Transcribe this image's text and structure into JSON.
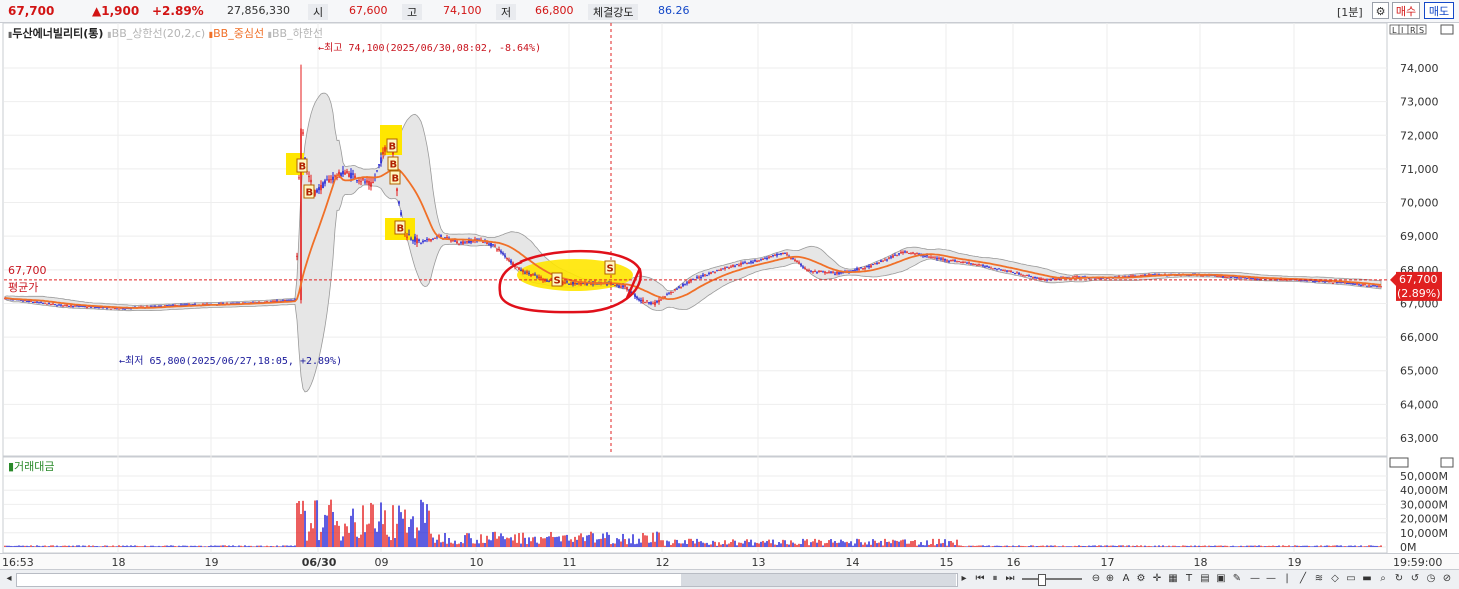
{
  "header": {
    "price": "67,700",
    "change": "▲1,900",
    "change_pct": "+2.89%",
    "volume": "27,856,330",
    "open_label": "시",
    "open_value": "67,600",
    "high_label": "고",
    "high_value": "74,100",
    "low_label": "저",
    "low_value": "66,800",
    "strength_label": "체결강도",
    "strength_value": "86.26",
    "interval": "[1분]",
    "buy_label": "매수",
    "sell_label": "매도"
  },
  "main_legend": {
    "name": "두산에너빌리티(통)",
    "bb_upper": "BB_상한선(20,2,c)",
    "bb_mid": "BB_중심선",
    "bb_lower": "BB_하한선"
  },
  "annotations": {
    "high": "←최고 74,100(2025/06/30,08:02, -8.64%)",
    "low": "←최저 65,800(2025/06/27,18:05, +2.89%)",
    "avg_value": "67,700",
    "avg_label": "평균가",
    "price_tag": "67,700",
    "price_tag_pct": "(2.89%)"
  },
  "price_axis": [
    "74,000",
    "73,000",
    "72,000",
    "71,000",
    "70,000",
    "69,000",
    "68,000",
    "67,000",
    "66,000",
    "65,000",
    "64,000",
    "63,000"
  ],
  "volume_legend": "거래대금",
  "volume_axis": [
    "50,000M",
    "40,000M",
    "30,000M",
    "20,000M",
    "10,000M",
    "0M"
  ],
  "time_axis": [
    "16:53",
    "18",
    "19",
    "06/30",
    "09",
    "10",
    "11",
    "12",
    "13",
    "14",
    "15",
    "16",
    "17",
    "18",
    "19",
    "19:59:00"
  ],
  "corner_tags": "LIRS",
  "chart_data": {
    "type": "candlestick",
    "ylim": [
      62700,
      74800
    ],
    "average_price": 67700,
    "last_price": 67700,
    "annotated_high": 74100,
    "annotated_low": 65800,
    "series": [
      {
        "name": "BB_중심선",
        "color": "#f07028"
      },
      {
        "name": "BB_상한선(20,2,c)"
      },
      {
        "name": "BB_하한선"
      }
    ],
    "signals": [
      "B",
      "B",
      "B",
      "B",
      "B",
      "B",
      "S",
      "S"
    ]
  },
  "colors": {
    "up": "#e41b1b",
    "down": "#1a1ad4",
    "bb_mid": "#f07028",
    "band_fill": "#e6e6e6",
    "highlight": "#ffe600",
    "circle": "#e0101a"
  }
}
